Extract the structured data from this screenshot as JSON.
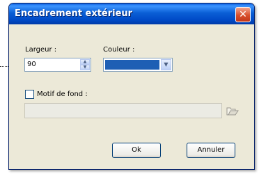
{
  "dialog": {
    "title": "Encadrement extérieur",
    "close_label": "✕"
  },
  "width": {
    "label": "Largeur :",
    "value": "90"
  },
  "color": {
    "label": "Couleur :",
    "swatch_color": "#1e5fb4"
  },
  "background_pattern": {
    "label": "Motif de fond :",
    "checked": false,
    "path_value": ""
  },
  "buttons": {
    "ok": "Ok",
    "cancel": "Annuler"
  }
}
